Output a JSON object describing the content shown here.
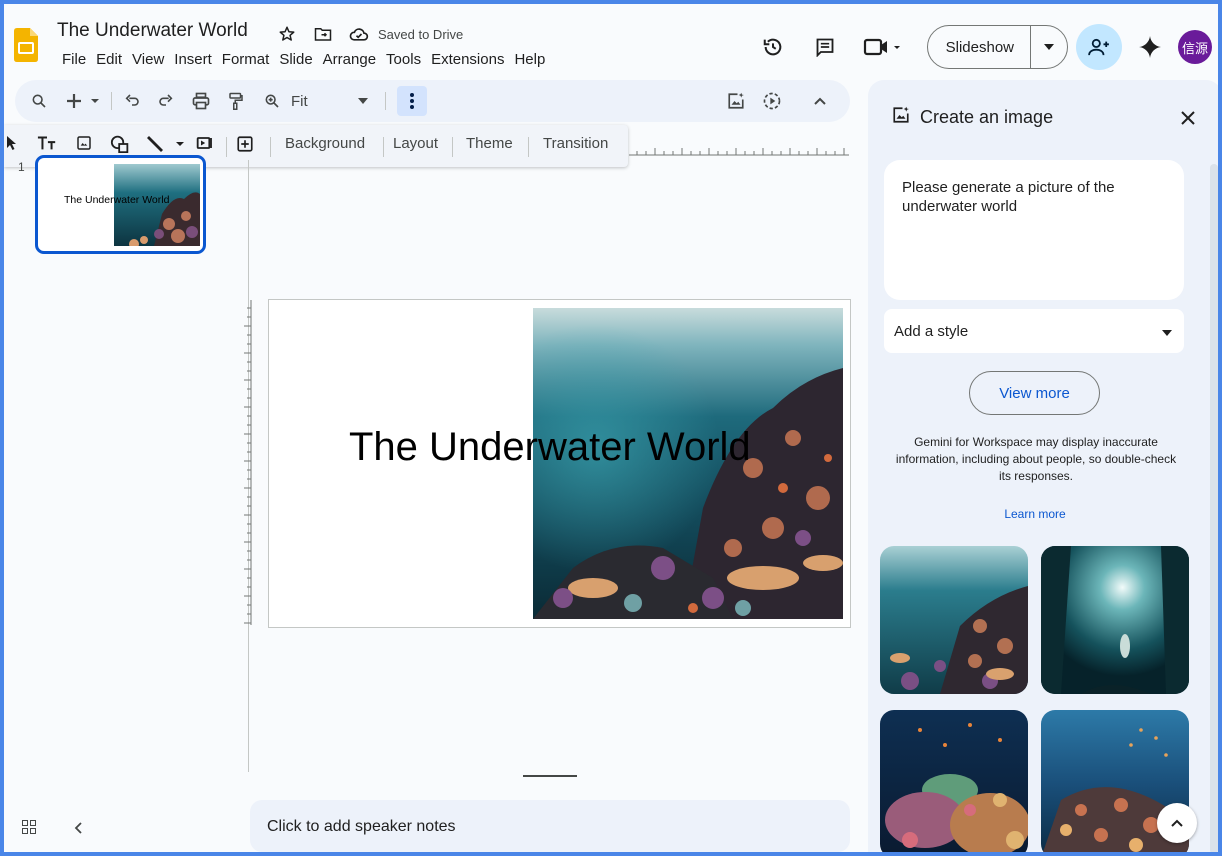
{
  "document": {
    "title": "The Underwater World",
    "save_status": "Saved to Drive"
  },
  "menu": {
    "items": [
      "File",
      "Edit",
      "View",
      "Insert",
      "Format",
      "Slide",
      "Arrange",
      "Tools",
      "Extensions",
      "Help"
    ]
  },
  "header_actions": {
    "slideshow_label": "Slideshow",
    "avatar_initials": "信源"
  },
  "toolbar": {
    "zoom_label": "Fit"
  },
  "slide_toolbar": {
    "background_label": "Background",
    "layout_label": "Layout",
    "theme_label": "Theme",
    "transition_label": "Transition"
  },
  "filmstrip": {
    "slides": [
      {
        "number": "1",
        "title": "The Underwater World"
      }
    ]
  },
  "slide": {
    "title": "The Underwater World"
  },
  "notes": {
    "placeholder": "Click to add speaker notes"
  },
  "side_panel": {
    "title": "Create an image",
    "prompt_text": "Please generate a picture of the underwater world",
    "style_placeholder": "Add a style",
    "view_more_label": "View more",
    "disclaimer": "Gemini for Workspace may display inaccurate information, including about people, so double-check its responses.",
    "learn_more_label": "Learn more"
  },
  "colors": {
    "accent_blue": "#0b57d0",
    "share_button": "#c2e7ff",
    "avatar": "#6a1b9a",
    "slides_yellow": "#f4b400"
  }
}
